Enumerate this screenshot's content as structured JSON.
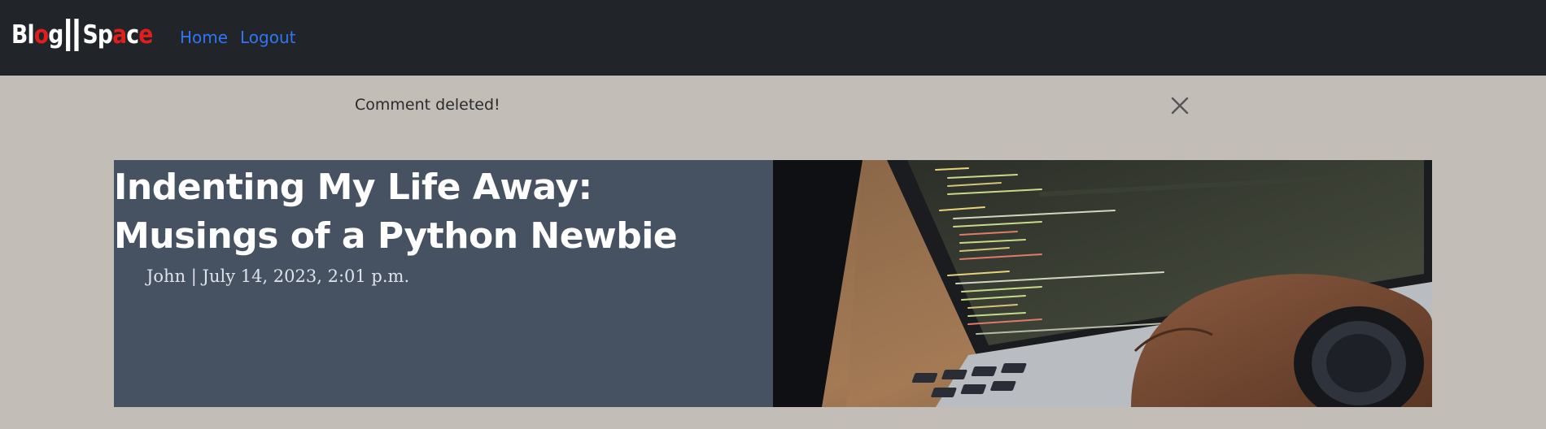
{
  "navbar": {
    "brand": {
      "part1": "Bl",
      "part1_red": "o",
      "part1_end": "g",
      "part2_a": "Sp",
      "part2_red": "a",
      "part2_b": "c",
      "part2_red2": "e"
    },
    "links": [
      {
        "label": "Home"
      },
      {
        "label": "Logout"
      }
    ],
    "link_color": "#2f76f5",
    "background": "#212529"
  },
  "alert": {
    "message": "Comment deleted!",
    "close_icon": "close-icon"
  },
  "post": {
    "title": "Indenting My Life Away: Musings of a Python Newbie",
    "author": "John",
    "date": "July 14, 2023, 2:01 p.m.",
    "meta": "John | July 14, 2023, 2:01 p.m.",
    "image_alt": "laptop-with-code-photo",
    "panel_color": "#465262"
  },
  "page": {
    "background": "#c2bdb6"
  }
}
